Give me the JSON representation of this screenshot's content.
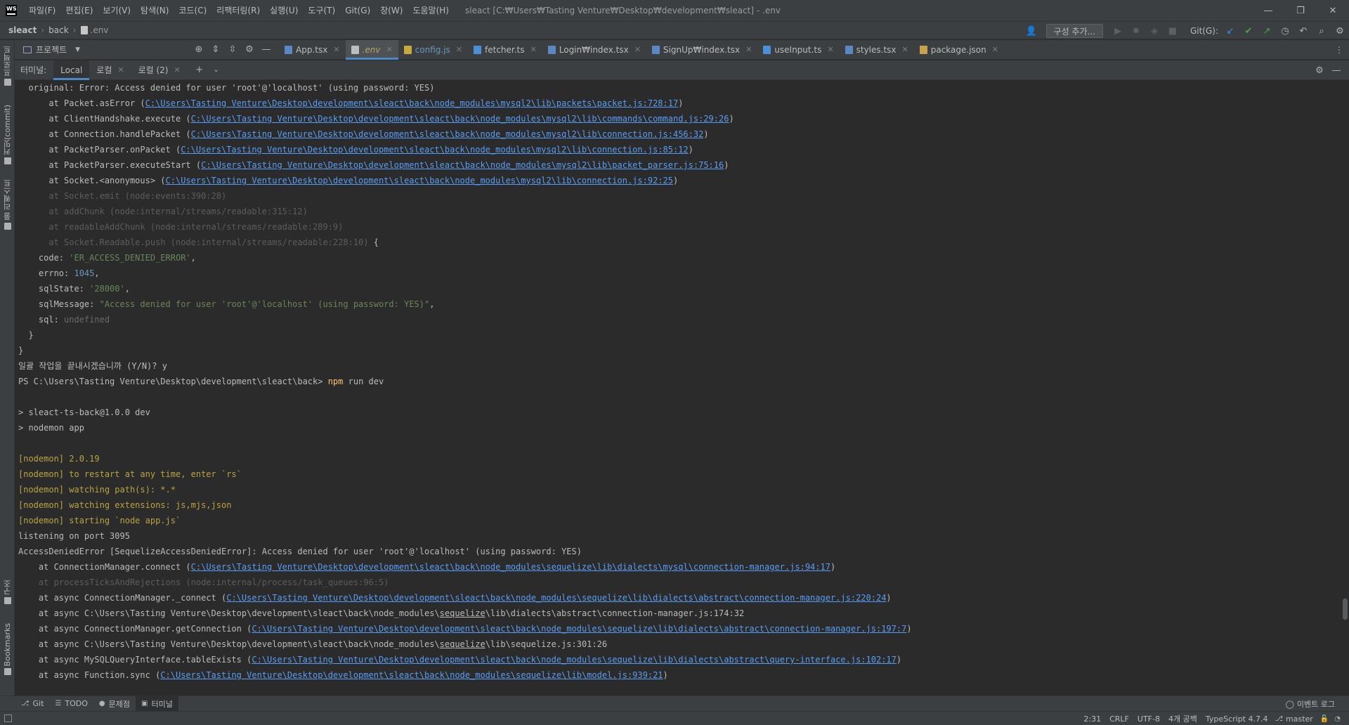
{
  "app": {
    "logo": "WS",
    "menu": [
      "파일(F)",
      "편집(E)",
      "보기(V)",
      "탐색(N)",
      "코드(C)",
      "리팩터링(R)",
      "실행(U)",
      "도구(T)",
      "Git(G)",
      "창(W)",
      "도움말(H)"
    ],
    "window_title": "sleact [C:₩Users₩Tasting Venture₩Desktop₩development₩sleact] - .env",
    "window_controls": [
      "—",
      "❐",
      "✕"
    ]
  },
  "navbar": {
    "breadcrumb": [
      "sleact",
      "back",
      ".env"
    ],
    "config_button": "구성 추가...",
    "git_label": "Git(G):"
  },
  "left_strip": {
    "items": [
      "프로젝트",
      "커밋(commit)",
      "풀 리퀘스트",
      "구조",
      "Bookmarks"
    ]
  },
  "editor": {
    "project_selector": "프로젝트",
    "tabs": [
      {
        "label": "App.tsx",
        "type": "tsx",
        "state": "normal"
      },
      {
        "label": ".env",
        "type": "env",
        "state": "active"
      },
      {
        "label": "config.js",
        "type": "js",
        "state": "modified"
      },
      {
        "label": "fetcher.ts",
        "type": "ts",
        "state": "normal"
      },
      {
        "label": "Login₩index.tsx",
        "type": "tsx",
        "state": "normal"
      },
      {
        "label": "SignUp₩index.tsx",
        "type": "tsx",
        "state": "normal"
      },
      {
        "label": "useInput.ts",
        "type": "ts",
        "state": "normal"
      },
      {
        "label": "styles.tsx",
        "type": "tsx",
        "state": "normal"
      },
      {
        "label": "package.json",
        "type": "json",
        "state": "normal"
      }
    ]
  },
  "terminal": {
    "title": "터미널:",
    "tabs": [
      {
        "label": "Local",
        "active": true
      },
      {
        "label": "로컬",
        "active": false
      },
      {
        "label": "로컬 (2)",
        "active": false
      }
    ],
    "lines": [
      [
        {
          "t": "  original: Error: Access denied for user 'root'@'localhost' (using password: YES)",
          "c": "def"
        }
      ],
      [
        {
          "t": "      at Packet.asError (",
          "c": "def"
        },
        {
          "t": "C:\\Users\\Tasting Venture\\Desktop\\development\\sleact\\back\\node_modules\\mysql2\\lib\\packets\\packet.js:728:17",
          "c": "link"
        },
        {
          "t": ")",
          "c": "def"
        }
      ],
      [
        {
          "t": "      at ClientHandshake.execute (",
          "c": "def"
        },
        {
          "t": "C:\\Users\\Tasting Venture\\Desktop\\development\\sleact\\back\\node_modules\\mysql2\\lib\\commands\\command.js:29:26",
          "c": "link"
        },
        {
          "t": ")",
          "c": "def"
        }
      ],
      [
        {
          "t": "      at Connection.handlePacket (",
          "c": "def"
        },
        {
          "t": "C:\\Users\\Tasting Venture\\Desktop\\development\\sleact\\back\\node_modules\\mysql2\\lib\\connection.js:456:32",
          "c": "link"
        },
        {
          "t": ")",
          "c": "def"
        }
      ],
      [
        {
          "t": "      at PacketParser.onPacket (",
          "c": "def"
        },
        {
          "t": "C:\\Users\\Tasting Venture\\Desktop\\development\\sleact\\back\\node_modules\\mysql2\\lib\\connection.js:85:12",
          "c": "link"
        },
        {
          "t": ")",
          "c": "def"
        }
      ],
      [
        {
          "t": "      at PacketParser.executeStart (",
          "c": "def"
        },
        {
          "t": "C:\\Users\\Tasting Venture\\Desktop\\development\\sleact\\back\\node_modules\\mysql2\\lib\\packet_parser.js:75:16",
          "c": "link"
        },
        {
          "t": ")",
          "c": "def"
        }
      ],
      [
        {
          "t": "      at Socket.<anonymous> (",
          "c": "def"
        },
        {
          "t": "C:\\Users\\Tasting Venture\\Desktop\\development\\sleact\\back\\node_modules\\mysql2\\lib\\connection.js:92:25",
          "c": "link"
        },
        {
          "t": ")",
          "c": "def"
        }
      ],
      [
        {
          "t": "      at Socket.emit (node:events:390:28)",
          "c": "dim"
        }
      ],
      [
        {
          "t": "      at addChunk (node:internal/streams/readable:315:12)",
          "c": "dim"
        }
      ],
      [
        {
          "t": "      at readableAddChunk (node:internal/streams/readable:289:9)",
          "c": "dim"
        }
      ],
      [
        {
          "t": "      at Socket.Readable.push (node:internal/streams/readable:228:10)",
          "c": "dim"
        },
        {
          "t": " {",
          "c": "def"
        }
      ],
      [
        {
          "t": "    code: ",
          "c": "def"
        },
        {
          "t": "'ER_ACCESS_DENIED_ERROR'",
          "c": "str"
        },
        {
          "t": ",",
          "c": "def"
        }
      ],
      [
        {
          "t": "    errno: ",
          "c": "def"
        },
        {
          "t": "1045",
          "c": "num"
        },
        {
          "t": ",",
          "c": "def"
        }
      ],
      [
        {
          "t": "    sqlState: ",
          "c": "def"
        },
        {
          "t": "'28000'",
          "c": "str"
        },
        {
          "t": ",",
          "c": "def"
        }
      ],
      [
        {
          "t": "    sqlMessage: ",
          "c": "def"
        },
        {
          "t": "\"Access denied for user 'root'@'localhost' (using password: YES)\"",
          "c": "str"
        },
        {
          "t": ",",
          "c": "def"
        }
      ],
      [
        {
          "t": "    sql: ",
          "c": "def"
        },
        {
          "t": "undefined",
          "c": "undef"
        }
      ],
      [
        {
          "t": "  }",
          "c": "def"
        }
      ],
      [
        {
          "t": "}",
          "c": "def"
        }
      ],
      [
        {
          "t": "일괄 작업을 끝내시겠습니까 (Y/N)? y",
          "c": "def"
        }
      ],
      [
        {
          "t": "PS C:\\Users\\Tasting Venture\\Desktop\\development\\sleact\\back> ",
          "c": "def"
        },
        {
          "t": "npm",
          "c": "cmd"
        },
        {
          "t": " run dev",
          "c": "def"
        }
      ],
      [
        {
          "t": "",
          "c": "def"
        }
      ],
      [
        {
          "t": "> sleact-ts-back@1.0.0 dev",
          "c": "def"
        }
      ],
      [
        {
          "t": "> nodemon app",
          "c": "def"
        }
      ],
      [
        {
          "t": "",
          "c": "def"
        }
      ],
      [
        {
          "t": "[nodemon] 2.0.19",
          "c": "warn"
        }
      ],
      [
        {
          "t": "[nodemon] to restart at any time, enter `rs`",
          "c": "warn"
        }
      ],
      [
        {
          "t": "[nodemon] watching path(s): *.*",
          "c": "warn"
        }
      ],
      [
        {
          "t": "[nodemon] watching extensions: js,mjs,json",
          "c": "warn"
        }
      ],
      [
        {
          "t": "[nodemon] starting `node app.js`",
          "c": "warn"
        }
      ],
      [
        {
          "t": "listening on port 3095",
          "c": "def"
        }
      ],
      [
        {
          "t": "AccessDeniedError [SequelizeAccessDeniedError]: Access denied for user 'root'@'localhost' (using password: YES)",
          "c": "def"
        }
      ],
      [
        {
          "t": "    at ConnectionManager.connect (",
          "c": "def"
        },
        {
          "t": "C:\\Users\\Tasting Venture\\Desktop\\development\\sleact\\back\\node_modules\\sequelize\\lib\\dialects\\mysql\\connection-manager.js:94:17",
          "c": "link"
        },
        {
          "t": ")",
          "c": "def"
        }
      ],
      [
        {
          "t": "    at processTicksAndRejections (node:internal/process/task_queues:96:5)",
          "c": "dim"
        }
      ],
      [
        {
          "t": "    at async ConnectionManager._connect (",
          "c": "def"
        },
        {
          "t": "C:\\Users\\Tasting Venture\\Desktop\\development\\sleact\\back\\node_modules\\sequelize\\lib\\dialects\\abstract\\connection-manager.js:220:24",
          "c": "link"
        },
        {
          "t": ")",
          "c": "def"
        }
      ],
      [
        {
          "t": "    at async C:\\Users\\Tasting Venture\\Desktop\\development\\sleact\\back\\node_modules\\",
          "c": "def"
        },
        {
          "t": "sequelize",
          "c": "ul"
        },
        {
          "t": "\\lib\\dialects\\abstract\\connection-manager.js:174:32",
          "c": "def"
        }
      ],
      [
        {
          "t": "    at async ConnectionManager.getConnection (",
          "c": "def"
        },
        {
          "t": "C:\\Users\\Tasting Venture\\Desktop\\development\\sleact\\back\\node_modules\\sequelize\\lib\\dialects\\abstract\\connection-manager.js:197:7",
          "c": "link"
        },
        {
          "t": ")",
          "c": "def"
        }
      ],
      [
        {
          "t": "    at async C:\\Users\\Tasting Venture\\Desktop\\development\\sleact\\back\\node_modules\\",
          "c": "def"
        },
        {
          "t": "sequelize",
          "c": "ul"
        },
        {
          "t": "\\lib\\sequelize.js:301:26",
          "c": "def"
        }
      ],
      [
        {
          "t": "    at async MySQLQueryInterface.tableExists (",
          "c": "def"
        },
        {
          "t": "C:\\Users\\Tasting Venture\\Desktop\\development\\sleact\\back\\node_modules\\sequelize\\lib\\dialects\\abstract\\query-interface.js:102:17",
          "c": "link"
        },
        {
          "t": ")",
          "c": "def"
        }
      ],
      [
        {
          "t": "    at async Function.sync (",
          "c": "def"
        },
        {
          "t": "C:\\Users\\Tasting Venture\\Desktop\\development\\sleact\\back\\node_modules\\sequelize\\lib\\model.js:939:21",
          "c": "link"
        },
        {
          "t": ")",
          "c": "def"
        }
      ]
    ]
  },
  "bottom_tabs": [
    {
      "label": "Git",
      "icon": "git-icon",
      "active": false
    },
    {
      "label": "TODO",
      "icon": "list-icon",
      "active": false
    },
    {
      "label": "문제점",
      "icon": "problems-icon",
      "active": false
    },
    {
      "label": "터미널",
      "icon": "terminal-icon",
      "active": true
    }
  ],
  "event_log": "이벤트 로그",
  "statusbar": {
    "position": "2:31",
    "line_sep": "CRLF",
    "encoding": "UTF-8",
    "indent": "4개 공백",
    "language": "TypeScript 4.7.4",
    "branch": "master"
  }
}
